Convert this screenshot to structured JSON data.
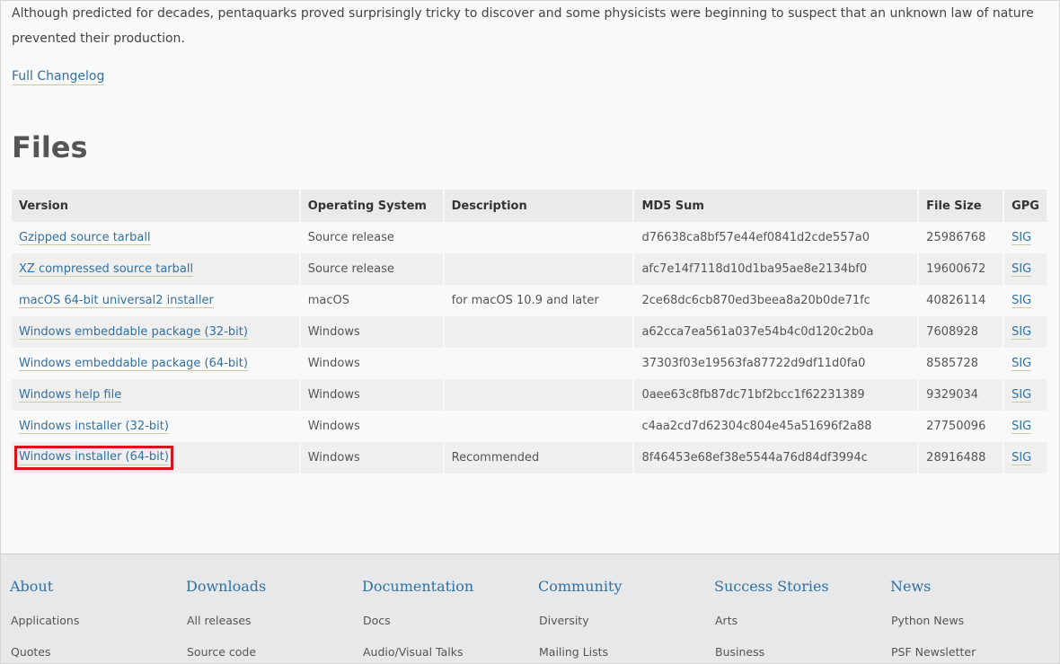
{
  "intro": {
    "text": "Although predicted for decades, pentaquarks proved surprisingly tricky to discover and some physicists were beginning to suspect that an unknown law of nature prevented their production."
  },
  "changelog_link": "Full Changelog",
  "files_heading": "Files",
  "table": {
    "headers": [
      "Version",
      "Operating System",
      "Description",
      "MD5 Sum",
      "File Size",
      "GPG"
    ],
    "rows": [
      {
        "version": "Gzipped source tarball",
        "os": "Source release",
        "description": "",
        "md5": "d76638ca8bf57e44ef0841d2cde557a0",
        "size": "25986768",
        "gpg": "SIG"
      },
      {
        "version": "XZ compressed source tarball",
        "os": "Source release",
        "description": "",
        "md5": "afc7e14f7118d10d1ba95ae8e2134bf0",
        "size": "19600672",
        "gpg": "SIG"
      },
      {
        "version": "macOS 64-bit universal2 installer",
        "os": "macOS",
        "description": "for macOS 10.9 and later",
        "md5": "2ce68dc6cb870ed3beea8a20b0de71fc",
        "size": "40826114",
        "gpg": "SIG"
      },
      {
        "version": "Windows embeddable package (32-bit)",
        "os": "Windows",
        "description": "",
        "md5": "a62cca7ea561a037e54b4c0d120c2b0a",
        "size": "7608928",
        "gpg": "SIG"
      },
      {
        "version": "Windows embeddable package (64-bit)",
        "os": "Windows",
        "description": "",
        "md5": "37303f03e19563fa87722d9df11d0fa0",
        "size": "8585728",
        "gpg": "SIG"
      },
      {
        "version": "Windows help file",
        "os": "Windows",
        "description": "",
        "md5": "0aee63c8fb87dc71bf2bcc1f62231389",
        "size": "9329034",
        "gpg": "SIG"
      },
      {
        "version": "Windows installer (32-bit)",
        "os": "Windows",
        "description": "",
        "md5": "c4aa2cd7d62304c804e45a51696f2a88",
        "size": "27750096",
        "gpg": "SIG"
      },
      {
        "version": "Windows installer (64-bit)",
        "os": "Windows",
        "description": "Recommended",
        "md5": "8f46453e68ef38e5544a76d84df3994c",
        "size": "28916488",
        "gpg": "SIG"
      }
    ]
  },
  "footer": {
    "columns": [
      {
        "heading": "About",
        "links": [
          "Applications",
          "Quotes"
        ]
      },
      {
        "heading": "Downloads",
        "links": [
          "All releases",
          "Source code"
        ]
      },
      {
        "heading": "Documentation",
        "links": [
          "Docs",
          "Audio/Visual Talks"
        ]
      },
      {
        "heading": "Community",
        "links": [
          "Diversity",
          "Mailing Lists"
        ]
      },
      {
        "heading": "Success Stories",
        "links": [
          "Arts",
          "Business"
        ]
      },
      {
        "heading": "News",
        "links": [
          "Python News",
          "PSF Newsletter"
        ]
      }
    ]
  },
  "colors": {
    "link": "#3171a3",
    "highlight_box": "#d8131c",
    "heading": "#555555"
  }
}
